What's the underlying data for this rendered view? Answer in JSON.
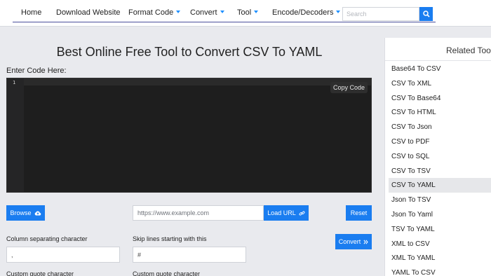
{
  "nav": {
    "items": [
      {
        "label": "Home",
        "dropdown": false
      },
      {
        "label": "Download Website",
        "dropdown": false
      },
      {
        "label": "Format Code",
        "dropdown": true
      },
      {
        "label": "Convert",
        "dropdown": true
      },
      {
        "label": "Tool",
        "dropdown": true
      },
      {
        "label": "Encode/Decoders",
        "dropdown": true
      }
    ],
    "search_placeholder": "Search",
    "search_icon": "search-icon"
  },
  "main": {
    "title": "Best Online Free Tool to Convert CSV To YAML",
    "enter_label": "Enter Code Here:",
    "editor": {
      "line_number": "1",
      "copy_label": "Copy Code"
    },
    "browse_label": "Browse",
    "browse_icon": "cloud-upload-icon",
    "url_placeholder": "https://www.example.com",
    "load_url_label": "Load URL",
    "load_url_icon": "link-icon",
    "reset_label": "Reset",
    "convert_label": "Convert",
    "convert_icon": "double-chevron-right-icon",
    "fields": {
      "col_sep_label": "Column separating character",
      "col_sep_value": ",",
      "skip_label": "Skip lines starting with this",
      "skip_value": "#",
      "quote_label_1": "Custom quote character",
      "quote_label_2": "Custom quote character"
    }
  },
  "sidebar": {
    "title": "Related Tools",
    "active_index": 8,
    "items": [
      "Base64 To CSV",
      "CSV To XML",
      "CSV To Base64",
      "CSV To HTML",
      "CSV To Json",
      "CSV to PDF",
      "CSV to SQL",
      "CSV To TSV",
      "CSV To YAML",
      "Json To TSV",
      "Json To Yaml",
      "TSV To YAML",
      "XML to CSV",
      "XML To YAML",
      "YAML To CSV"
    ]
  },
  "colors": {
    "accent": "#1a7df0",
    "editor_bg": "#1e1e1e",
    "page_bg": "#e9eaee"
  }
}
